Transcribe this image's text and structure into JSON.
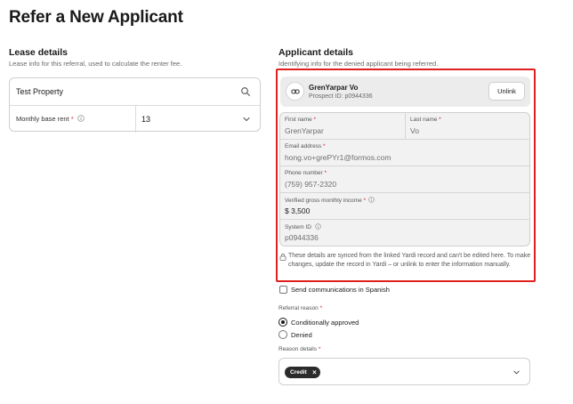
{
  "page": {
    "title": "Refer a New Applicant"
  },
  "lease": {
    "title": "Lease details",
    "subtitle": "Lease info for this referral, used to calculate the renter fee.",
    "property_value": "Test Property",
    "rent_label": "Monthly base rent",
    "rent_required": "*",
    "rent_value": "13"
  },
  "applicant": {
    "title": "Applicant details",
    "subtitle": "Identifying info for the denied applicant being referred.",
    "linked_name": "GrenYarpar Vo",
    "linked_prospect": "Prospect ID: p0944336",
    "unlink_label": "Unlink",
    "first_name": {
      "label": "First name",
      "req": "*",
      "value": "GrenYarpar"
    },
    "last_name": {
      "label": "Last name",
      "req": "*",
      "value": "Vo"
    },
    "email": {
      "label": "Email address",
      "req": "*",
      "value": "hong.vo+grePYr1@formos.com"
    },
    "phone": {
      "label": "Phone number",
      "req": "*",
      "value": "(759) 957-2320"
    },
    "income": {
      "label": "Verified gross monthly income",
      "req": "*",
      "value": "$ 3,500"
    },
    "system_id": {
      "label": "System ID",
      "value": "p0944336"
    },
    "sync_note": "These details are synced from the linked Yardi record and can't be edited here. To make changes, update the record in Yardi – or unlink to enter the information manually."
  },
  "communications": {
    "spanish_label": "Send communications in Spanish",
    "checked": false
  },
  "referral_reason": {
    "label": "Referral reason",
    "req": "*",
    "options": [
      {
        "label": "Conditionally approved",
        "selected": true
      },
      {
        "label": "Denied",
        "selected": false
      }
    ]
  },
  "reason_details": {
    "label": "Reason details",
    "req": "*",
    "chips": [
      "Credit"
    ],
    "chip_remove": "×"
  },
  "icons": {
    "search": "search-icon",
    "info": "info-icon",
    "chevron": "chevron-down-icon",
    "link": "link-icon",
    "lock": "lock-icon"
  },
  "colors": {
    "highlight": "#e0201c",
    "required": "#d0242b",
    "chip_bg": "#2b2b2b"
  }
}
